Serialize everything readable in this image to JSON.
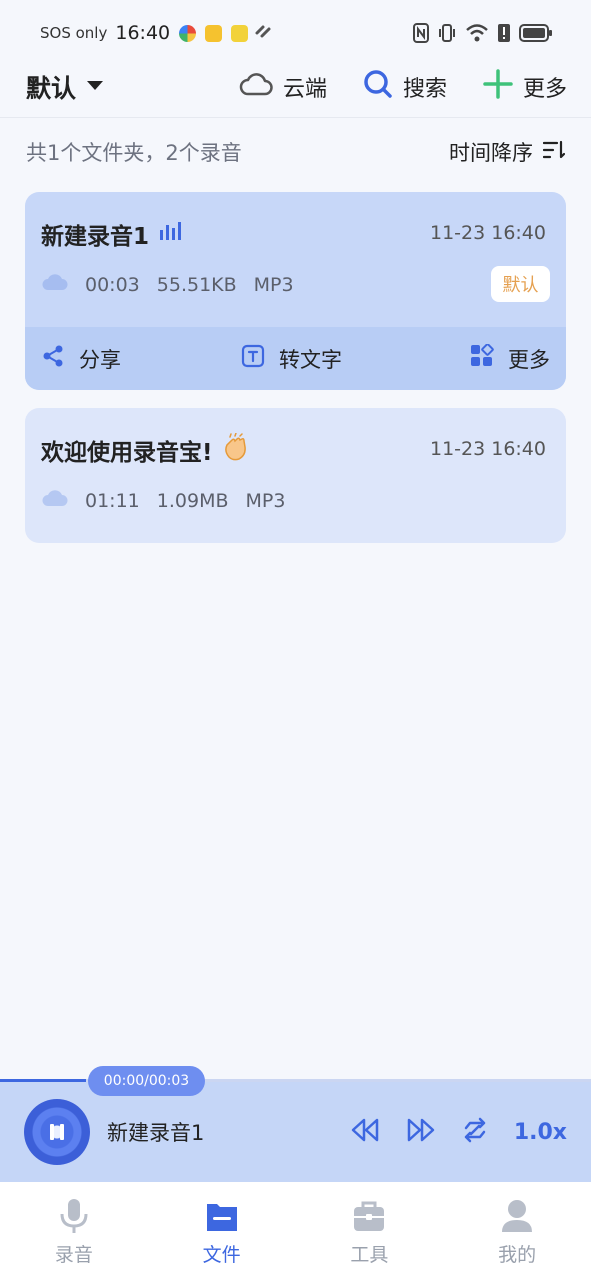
{
  "status_bar": {
    "carrier": "SOS only",
    "time": "16:40"
  },
  "header": {
    "folder_name": "默认",
    "cloud_label": "云端",
    "search_label": "搜索",
    "more_label": "更多"
  },
  "summary": {
    "text": "共1个文件夹，2个录音",
    "sort_label": "时间降序"
  },
  "recordings": [
    {
      "title": "新建录音1",
      "date": "11-23 16:40",
      "duration": "00:03",
      "size": "55.51KB",
      "format": "MP3",
      "badge": "默认",
      "actions": {
        "share": "分享",
        "to_text": "转文字",
        "more": "更多"
      }
    },
    {
      "title": "欢迎使用录音宝!",
      "date": "11-23 16:40",
      "duration": "01:11",
      "size": "1.09MB",
      "format": "MP3"
    }
  ],
  "player": {
    "time": "00:00/00:03",
    "progress": 0.145,
    "title": "新建录音1",
    "speed": "1.0x"
  },
  "bottom_nav": [
    {
      "label": "录音",
      "icon": "microphone-icon"
    },
    {
      "label": "文件",
      "icon": "folder-icon",
      "active": true
    },
    {
      "label": "工具",
      "icon": "toolbox-icon"
    },
    {
      "label": "我的",
      "icon": "person-icon"
    }
  ],
  "colors": {
    "accent": "#3d67e0",
    "card_highlight": "#c7d7f8",
    "card_normal": "#dde6fa",
    "badge_text": "#e5a050",
    "add_green": "#3ec27a"
  }
}
